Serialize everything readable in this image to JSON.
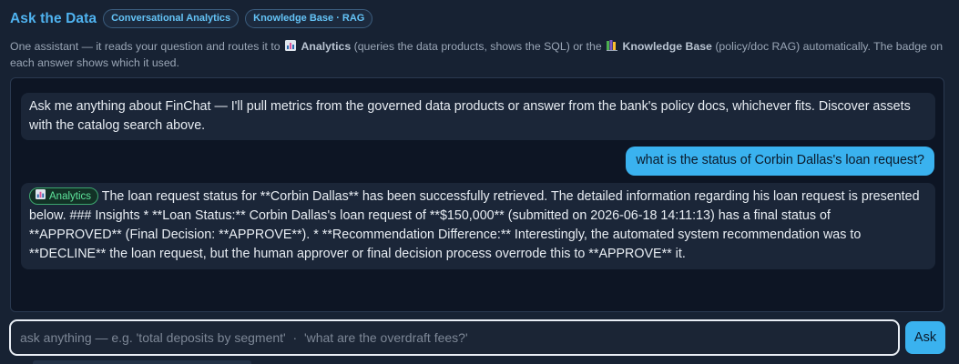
{
  "header": {
    "title": "Ask the Data",
    "tags": [
      "Conversational Analytics",
      "Knowledge Base · RAG"
    ]
  },
  "description": {
    "part1": "One assistant — it reads your question and routes it to",
    "analytics_label": "Analytics",
    "part2": "(queries the data products, shows the SQL) or the",
    "kb_label": "Knowledge Base",
    "part3": "(policy/doc RAG) automatically. The badge on each answer shows which it used."
  },
  "messages": [
    {
      "role": "assistant",
      "text": "Ask me anything about FinChat — I'll pull metrics from the governed data products or answer from the bank's policy docs, whichever fits. Discover assets with the catalog search above."
    },
    {
      "role": "user",
      "text": "what is the status of Corbin Dallas's loan request?"
    },
    {
      "role": "assistant",
      "badge": "Analytics",
      "text": "The loan request status for **Corbin Dallas** has been successfully retrieved. The detailed information regarding his loan request is presented below. ### Insights * **Loan Status:** Corbin Dallas's loan request of **$150,000** (submitted on 2026-06-18 14:11:13) has a final status of **APPROVED** (Final Decision: **APPROVE**). * **Recommendation Difference:** Interestingly, the automated system recommendation was to **DECLINE** the loan request, but the human approver or final decision process overrode this to **APPROVE** it."
    }
  ],
  "composer": {
    "placeholder": "ask anything — e.g. 'total deposits by segment'  ·  'what are the overdraft fees?'",
    "value": "",
    "ask_label": "Ask"
  },
  "icons": {
    "analytics": "bar-chart-icon",
    "knowledge_base": "books-icon"
  },
  "colors": {
    "accent": "#3ab2ef",
    "title": "#4fb3f0",
    "badge_analytics": "#5ee39b",
    "background": "#172233",
    "panel": "#0d1524"
  }
}
